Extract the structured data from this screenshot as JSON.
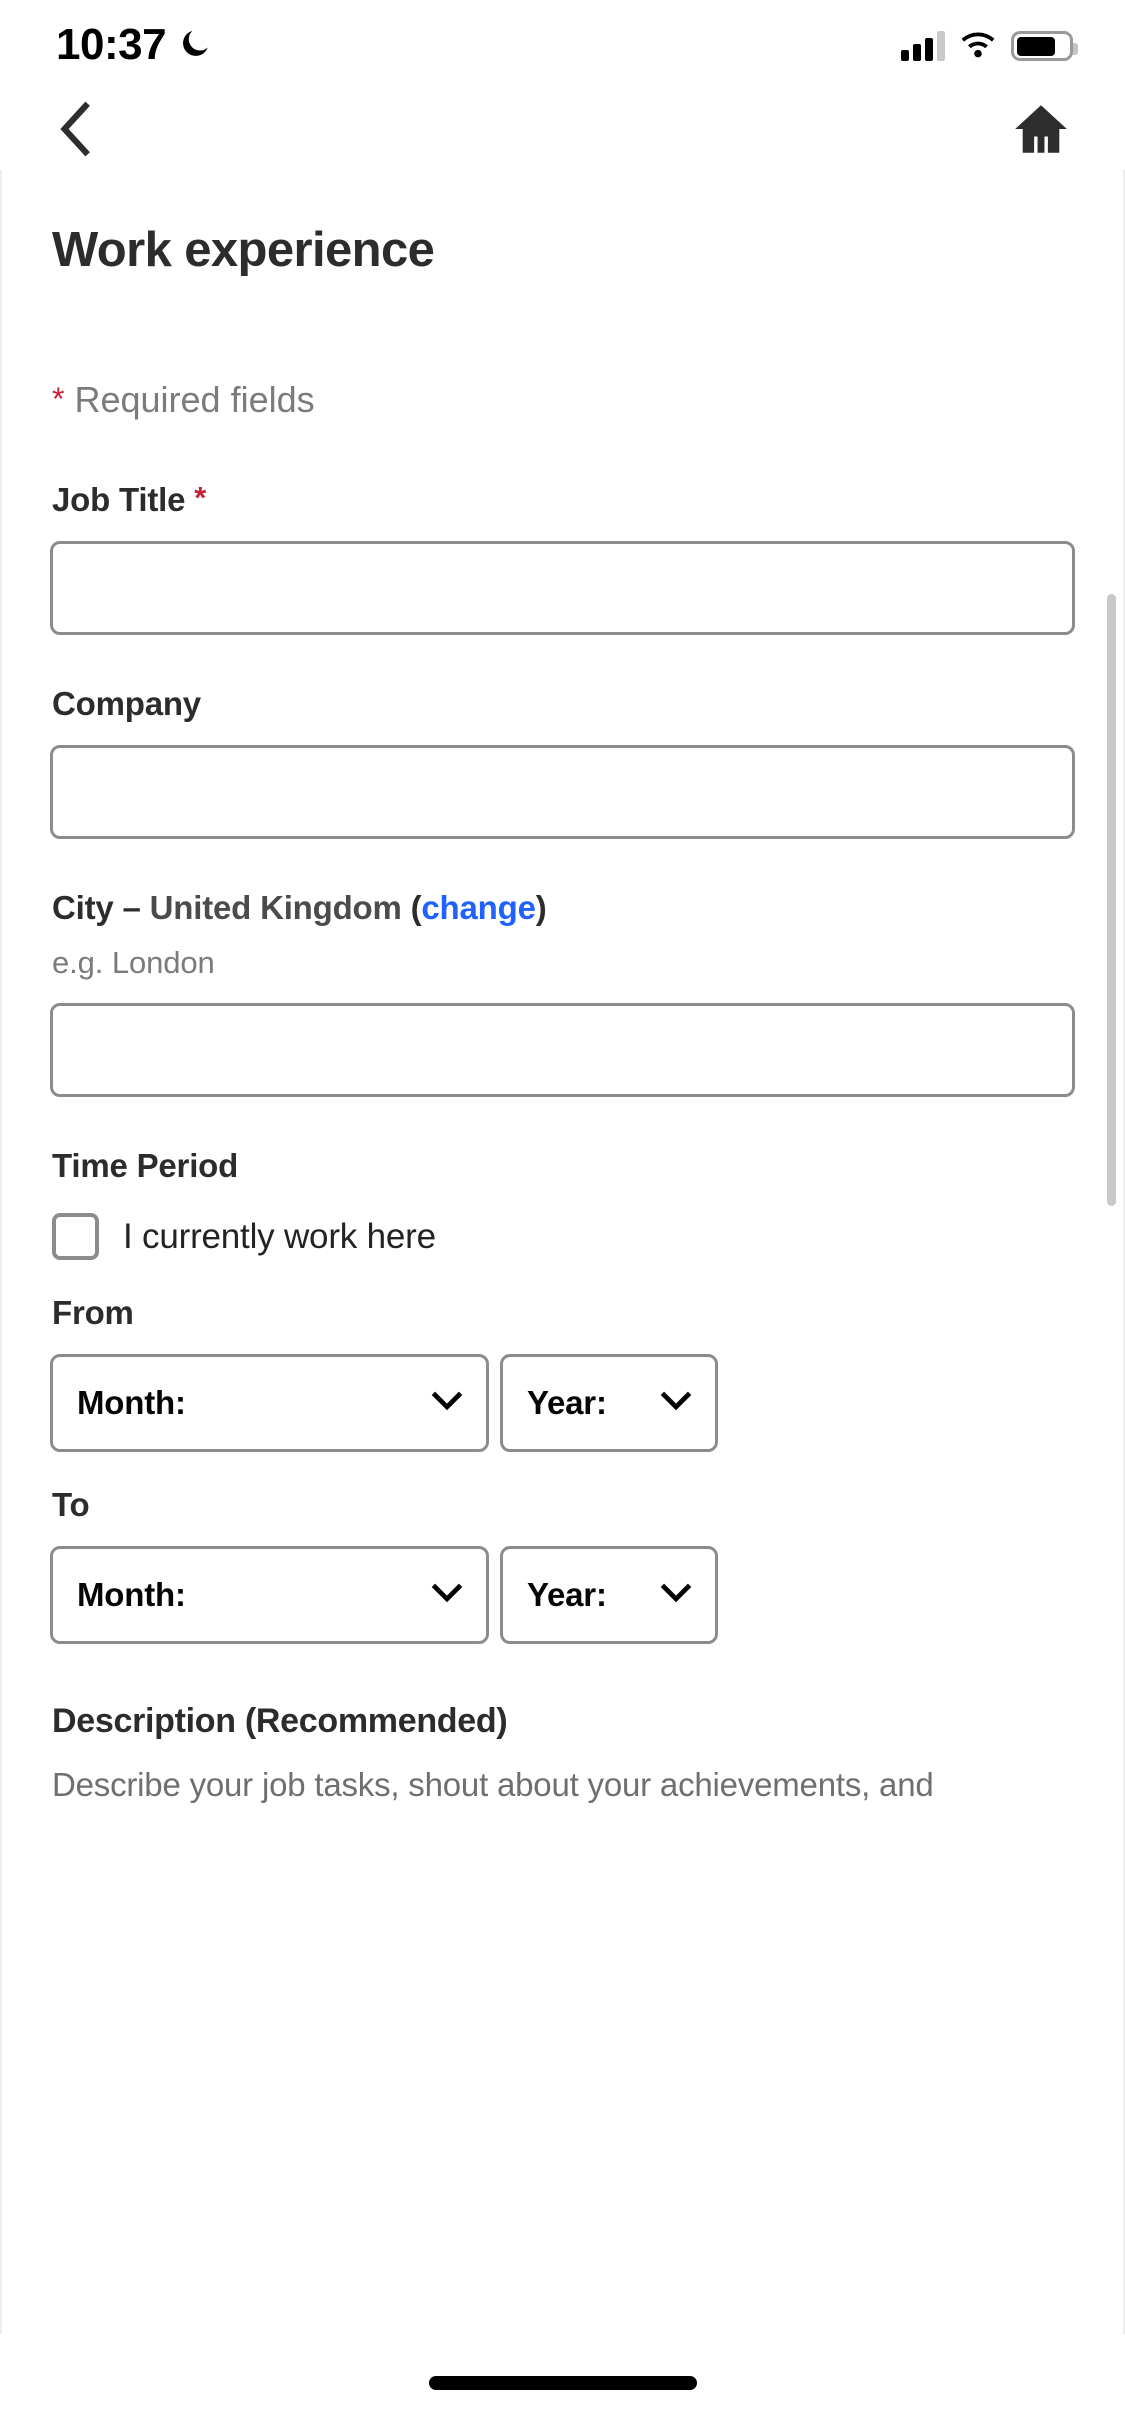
{
  "status_bar": {
    "time": "10:37",
    "dnd_icon": "crescent-moon-icon",
    "signal_icon": "cellular-signal-icon",
    "wifi_icon": "wifi-icon",
    "battery_icon": "battery-icon"
  },
  "nav_bar": {
    "back_icon": "chevron-left-icon",
    "home_icon": "home-icon"
  },
  "header": {
    "title": "Work experience"
  },
  "form": {
    "required_note": {
      "star": "*",
      "text": "Required fields"
    },
    "job_title": {
      "label": "Job Title",
      "star": "*",
      "value": "",
      "placeholder": ""
    },
    "company": {
      "label": "Company",
      "value": "",
      "placeholder": ""
    },
    "city": {
      "label_prefix": "City",
      "dash": "–",
      "country": "United Kingdom",
      "paren_open": "(",
      "change_link": "change",
      "paren_close": ")",
      "hint": "e.g. London",
      "value": "",
      "placeholder": ""
    },
    "time_period": {
      "label": "Time Period",
      "current_checkbox": {
        "label": "I currently work here",
        "checked": false
      },
      "from": {
        "label": "From",
        "month_value": "Month:",
        "year_value": "Year:"
      },
      "to": {
        "label": "To",
        "month_value": "Month:",
        "year_value": "Year:"
      }
    },
    "description": {
      "title": "Description (Recommended)",
      "body": "Describe your job tasks, shout about your achievements, and"
    }
  },
  "colors": {
    "required_star": "#c8213c",
    "link": "#1f62ff",
    "border": "#8c8c8c",
    "text_dark": "#2c2c2c",
    "text_muted": "#7b7b7b"
  }
}
